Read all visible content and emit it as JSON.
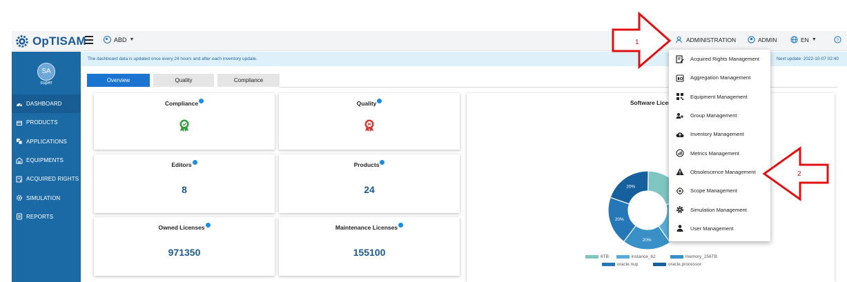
{
  "app": {
    "logo_text": "OpTISAM"
  },
  "header": {
    "scope_label": "ABD",
    "administration_label": "ADMINISTRATION",
    "user_label": "ADMIN",
    "language_label": "EN"
  },
  "sidebar": {
    "avatar_initials": "SA",
    "user_name": "super",
    "items": [
      {
        "label": "DASHBOARD",
        "icon": "dashboard-icon",
        "active": true
      },
      {
        "label": "PRODUCTS",
        "icon": "products-icon"
      },
      {
        "label": "APPLICATIONS",
        "icon": "applications-icon"
      },
      {
        "label": "EQUIPMENTS",
        "icon": "equipments-icon"
      },
      {
        "label": "ACQUIRED RIGHTS",
        "icon": "acquired-rights-icon"
      },
      {
        "label": "SIMULATION",
        "icon": "simulation-icon"
      },
      {
        "label": "REPORTS",
        "icon": "reports-icon"
      }
    ]
  },
  "notice": {
    "message": "The dashboard data is updated once every 24 hours and after each inventory update.",
    "last_update": "Next update: 2022-10-07 02:40"
  },
  "tabs": [
    {
      "label": "Overview",
      "active": true
    },
    {
      "label": "Quality"
    },
    {
      "label": "Compliance"
    }
  ],
  "cards": {
    "compliance": {
      "title": "Compliance",
      "status_color": "#2e9e3e"
    },
    "quality": {
      "title": "Quality",
      "status_color": "#d23a3a"
    },
    "editors": {
      "title": "Editors",
      "value": "8"
    },
    "products": {
      "title": "Products",
      "value": "24"
    },
    "owned_licenses": {
      "title": "Owned Licenses",
      "value": "971350"
    },
    "maintenance_licenses": {
      "title": "Maintenance Licenses",
      "value": "155100"
    }
  },
  "chart": {
    "title": "Software Licence Comp"
  },
  "chart_data": {
    "type": "pie",
    "title": "Software Licence Comp",
    "categories": [
      "8TB",
      "instance_62",
      "memory_256TB",
      "oracle.nup",
      "oracle.processor"
    ],
    "values": [
      20,
      20,
      20,
      20,
      20
    ],
    "colors": [
      "#7fc6c3",
      "#5aaad6",
      "#3890c6",
      "#2677b8",
      "#17609e"
    ],
    "visible_slice_labels": [
      "20%",
      "20%",
      "20%",
      "20%"
    ]
  },
  "admin_menu": {
    "items": [
      {
        "label": "Acquired Rights Management",
        "icon": "acquired-rights-icon"
      },
      {
        "label": "Aggregation Management",
        "icon": "aggregation-icon"
      },
      {
        "label": "Equipment Management",
        "icon": "equipment-icon"
      },
      {
        "label": "Group Management",
        "icon": "group-icon"
      },
      {
        "label": "Inventory Management",
        "icon": "inventory-icon"
      },
      {
        "label": "Metrics Management",
        "icon": "metrics-icon"
      },
      {
        "label": "Obsolescence Management",
        "icon": "warning-icon"
      },
      {
        "label": "Scope Management",
        "icon": "scope-icon"
      },
      {
        "label": "Simulation Management",
        "icon": "gear-icon"
      },
      {
        "label": "User Management",
        "icon": "user-icon"
      }
    ]
  },
  "annotations": {
    "arrow_1": "1",
    "arrow_2": "2",
    "color": "#e01010"
  }
}
